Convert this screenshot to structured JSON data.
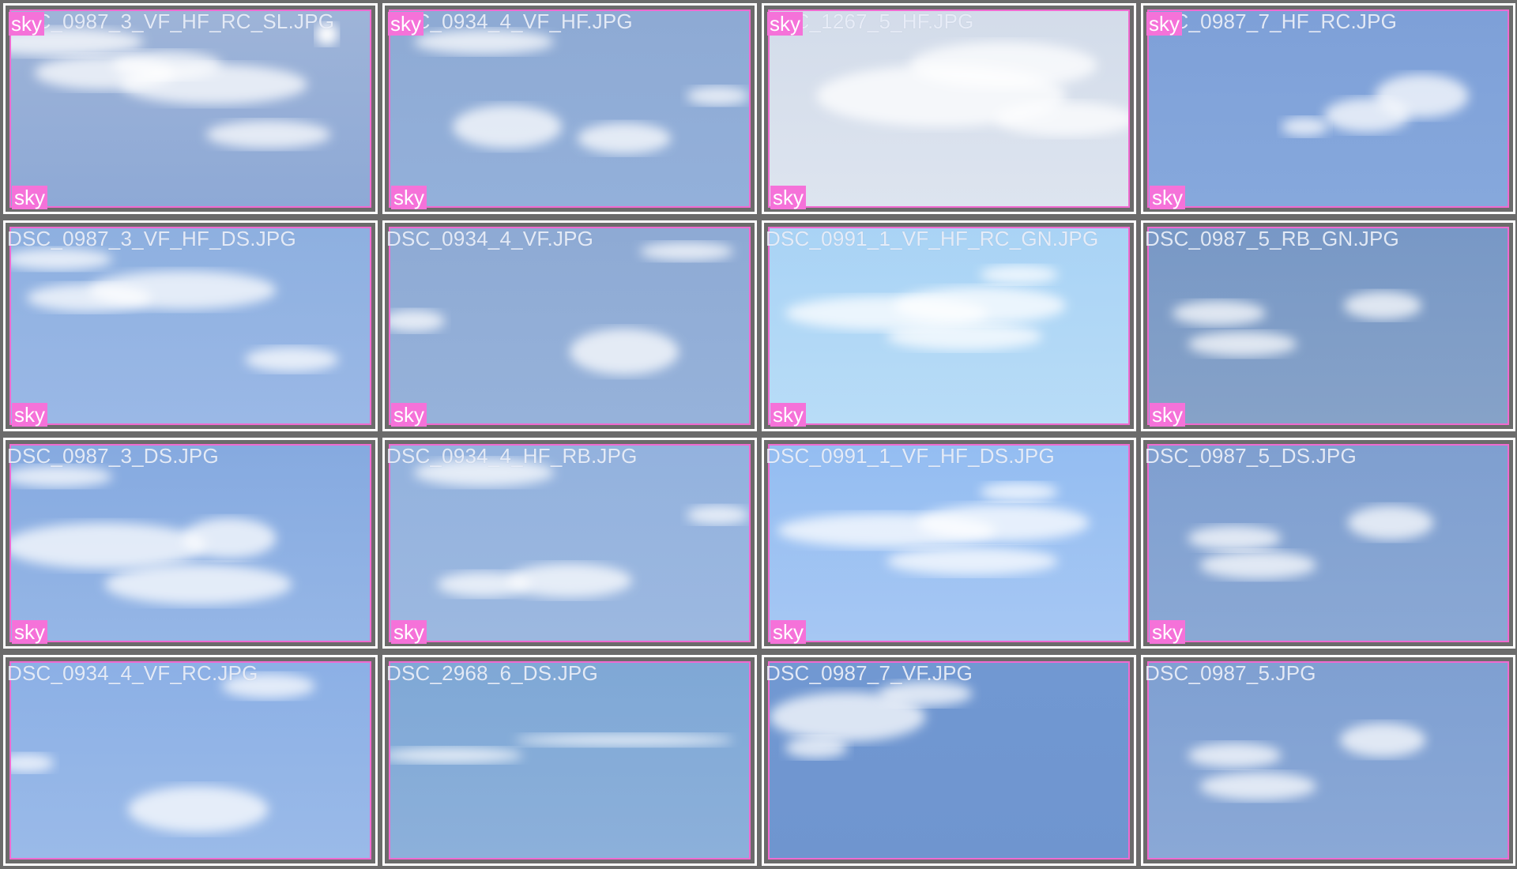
{
  "tag_label": "sky",
  "colors": {
    "background": "#6b6b6b",
    "tile_border": "#ffffff",
    "box_outline": "#f06ad0",
    "tag_fill": "#f572d9"
  },
  "tiles": [
    {
      "filename": "DSC_0987_3_VF_HF_RC_SL.JPG",
      "sky": [
        "#9eb4d8",
        "#8ea9d6"
      ],
      "tags": [
        "top",
        "bottom"
      ]
    },
    {
      "filename": "DSC_0934_4_VF_HF.JPG",
      "sky": [
        "#8eaad4",
        "#93b0da"
      ],
      "tags": [
        "top",
        "bottom"
      ]
    },
    {
      "filename": "DSC_1267_5_HF.JPG",
      "sky": [
        "#d3dcea",
        "#dde4ef"
      ],
      "tags": [
        "top",
        "bottom"
      ]
    },
    {
      "filename": "DSC_0987_7_HF_RC.JPG",
      "sky": [
        "#7ea0d8",
        "#86a8dc"
      ],
      "tags": [
        "top",
        "bottom"
      ]
    },
    {
      "filename": "DSC_0987_3_VF_HF_DS.JPG",
      "sky": [
        "#8eb0e0",
        "#9ab8e6"
      ],
      "tags": [
        "bottom"
      ]
    },
    {
      "filename": "DSC_0934_4_VF.JPG",
      "sky": [
        "#8eaad4",
        "#96b2da"
      ],
      "tags": [
        "bottom"
      ]
    },
    {
      "filename": "DSC_0991_1_VF_HF_RC_GN.JPG",
      "sky": [
        "#a9d3f5",
        "#b8dcf7"
      ],
      "tags": [
        "bottom"
      ]
    },
    {
      "filename": "DSC_0987_5_RB_GN.JPG",
      "sky": [
        "#7898c6",
        "#86a2c8"
      ],
      "tags": [
        "bottom"
      ]
    },
    {
      "filename": "DSC_0987_3_DS.JPG",
      "sky": [
        "#86aae0",
        "#95b6e6"
      ],
      "tags": [
        "bottom"
      ]
    },
    {
      "filename": "DSC_0934_4_HF_RB.JPG",
      "sky": [
        "#93b2de",
        "#9cb8e0"
      ],
      "tags": [
        "bottom"
      ]
    },
    {
      "filename": "DSC_0991_1_VF_HF_DS.JPG",
      "sky": [
        "#94bdf2",
        "#a6c7f3"
      ],
      "tags": [
        "bottom"
      ]
    },
    {
      "filename": "DSC_0987_5_DS.JPG",
      "sky": [
        "#7f9fd0",
        "#8aa8d4"
      ],
      "tags": [
        "bottom"
      ]
    },
    {
      "filename": "DSC_0934_4_VF_RC.JPG",
      "sky": [
        "#8cb0e6",
        "#9abae8"
      ],
      "tags": []
    },
    {
      "filename": "DSC_2968_6_DS.JPG",
      "sky": [
        "#7fa8d6",
        "#8cb0da"
      ],
      "tags": []
    },
    {
      "filename": "DSC_0987_7_VF.JPG",
      "sky": [
        "#7198d2",
        "#6f95cf"
      ],
      "tags": []
    },
    {
      "filename": "DSC_0987_5.JPG",
      "sky": [
        "#7fa0d2",
        "#8aa8d6"
      ],
      "tags": []
    }
  ]
}
